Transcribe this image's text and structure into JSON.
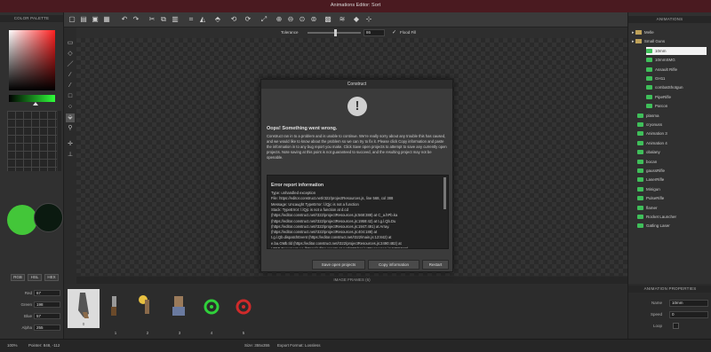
{
  "window": {
    "title": "Animations Editor: Sort"
  },
  "left": {
    "header": "COLOR PALETTE",
    "modes": [
      "RGB",
      "HSL",
      "HEX"
    ],
    "red_label": "Red",
    "red": "67",
    "green_label": "Green",
    "green": "198",
    "blue_label": "Blue",
    "blue": "57",
    "alpha_label": "Alpha",
    "alpha": "255",
    "primary": "#43c639",
    "secondary": "#0b1a10"
  },
  "options": {
    "tolerance_label": "Tolerance",
    "tolerance": "86",
    "fill_label": "Flood Fill"
  },
  "frames": {
    "header": "IMAGE FRAMES (6)",
    "numbers": [
      "0",
      "1",
      "2",
      "3",
      "4",
      "5"
    ]
  },
  "animations": {
    "header": "ANIMATIONS",
    "items": [
      {
        "label": "Melle",
        "type": "folder"
      },
      {
        "label": "Small Guns",
        "type": "folder"
      },
      {
        "label": "10mm",
        "type": "anim",
        "indent": true,
        "selected": true
      },
      {
        "label": "10mmSMG",
        "type": "anim",
        "indent": true
      },
      {
        "label": "Assault Rifle",
        "type": "anim",
        "indent": true
      },
      {
        "label": "GH11",
        "type": "anim",
        "indent": true
      },
      {
        "label": "combatShotgun",
        "type": "anim",
        "indent": true
      },
      {
        "label": "PipeRifle",
        "type": "anim",
        "indent": true
      },
      {
        "label": "Parcon",
        "type": "anim",
        "indent": true
      },
      {
        "label": "plasma",
        "type": "anim"
      },
      {
        "label": "cryonuss",
        "type": "anim"
      },
      {
        "label": "Animation 3",
        "type": "anim"
      },
      {
        "label": "Animation 4",
        "type": "anim"
      },
      {
        "label": "obalany",
        "type": "anim"
      },
      {
        "label": "bocan",
        "type": "anim"
      },
      {
        "label": "gaussRifle",
        "type": "anim"
      },
      {
        "label": "LaserRifle",
        "type": "anim"
      },
      {
        "label": "Minigun",
        "type": "anim"
      },
      {
        "label": "PulseRifle",
        "type": "anim"
      },
      {
        "label": "flamer",
        "type": "anim"
      },
      {
        "label": "Rocket Launcher",
        "type": "anim"
      },
      {
        "label": "Gatling Laser",
        "type": "anim"
      }
    ]
  },
  "properties": {
    "header": "ANIMATION PROPERTIES",
    "name_label": "Name",
    "name": "10mm",
    "speed_label": "Speed",
    "speed": "0",
    "loop_label": "Loop"
  },
  "status": {
    "zoom": "100%",
    "pointer": "Pointer: 848, -112",
    "size": "Size: 355x355",
    "format": "Export Format: Lossless"
  },
  "dialog": {
    "title": "Construct",
    "heading": "Oops! Something went wrong.",
    "p1": "Construct ran in to a problem and is unable to continue. We're really sorry about any trouble this has caused, and we would like to know about the problem so we can try to fix it. Please click Copy information and paste the information in to any bug report you make. Click Save open projects to attempt to save any currently open projects. Note saving at this point is not guaranteed to succeed, and the resulting project may not be openable.",
    "report_title": "Error report information",
    "lines": [
      "Type: unhandled exception",
      "File: https://editor.construct.net/r322/projectResources.js, line 568, col 388",
      "Message: Uncaught TypeError: l.lQjc is not a function",
      "Stack: TypeError: l.lQjc is not a function at d.cd",
      "(https://editor.construct.net/r322/projectResources.js:568:388) at C_a.hPb.ka",
      "(https://editor.construct.net/r322/projectResources.js:1959:42) at t.g.l.Qb.Du",
      "(https://editor.construct.net/r322/projectResources.js:1947:491) at Array.",
      "(https://editor.construct.net/r322/projectResources.js:404:188) at",
      "t.g.l.Qb.dispatchEvent (https://editor.construct.net/r322/main.js:12:842) at",
      "e.ba.GMb.tld (https://editor.construct.net/r322/projectResources.js:2490:482) at",
      "HTMLDocument.eq (https://editor.construct.net/r322/projectResources.js:2488:346)"
    ],
    "btn_save": "Save open projects",
    "btn_copy": "Copy information",
    "btn_restart": "Restart"
  }
}
